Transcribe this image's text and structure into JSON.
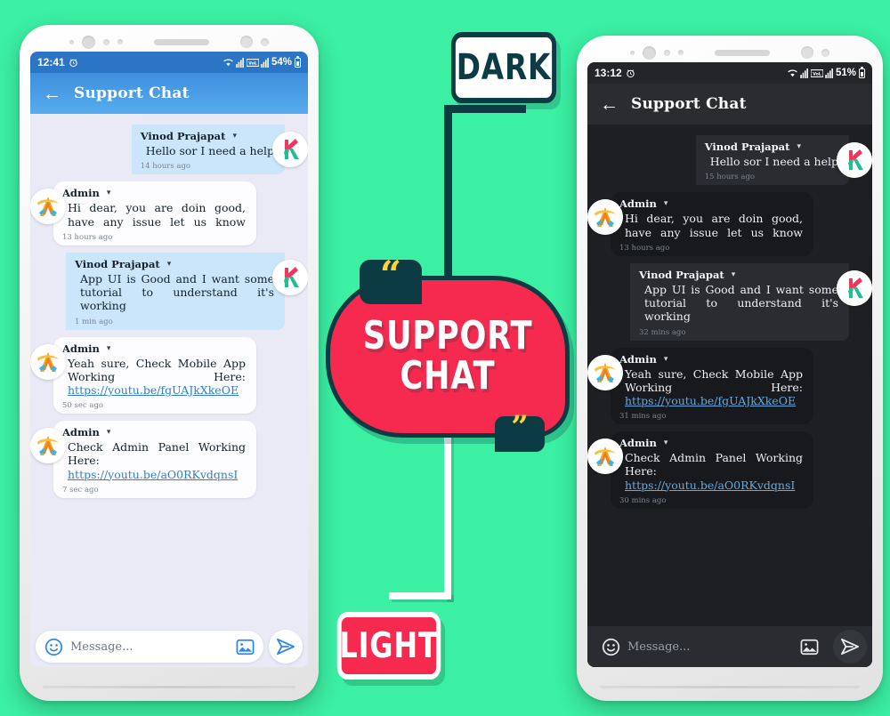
{
  "background_color": "#3BEFA3",
  "banner": {
    "line1": "SUPPORT",
    "line2": "CHAT",
    "quote_open": "“",
    "quote_close": "”",
    "color": "#F52A4E",
    "outline_color": "#0D3B44",
    "quote_color": "#FFD43B"
  },
  "labels": {
    "dark": "DARK",
    "light": "LIGHT"
  },
  "light_phone": {
    "status": {
      "time": "12:41",
      "battery": "54%",
      "wifi_icon": "wifi-icon",
      "signal_icon": "signal-icon",
      "alarm_icon": "alarm-icon"
    },
    "appbar": {
      "back_icon": "back-arrow-icon",
      "title": "Support Chat"
    },
    "messages": [
      {
        "sender": "Vinod Prajapat",
        "text": "Hello sor I need a help",
        "link": "",
        "time": "14 hours ago",
        "side": "right",
        "avatar": "k-logo-avatar"
      },
      {
        "sender": "Admin",
        "text": "Hi dear, you are doin good, have any issue let us know",
        "link": "",
        "time": "13 hours ago",
        "side": "left",
        "avatar": "a-logo-avatar"
      },
      {
        "sender": "Vinod Prajapat",
        "text": "App UI is Good and I want some tutorial to understand it's working",
        "link": "",
        "time": "1 min ago",
        "side": "right",
        "avatar": "k-logo-avatar"
      },
      {
        "sender": "Admin",
        "text": "Yeah sure, Check Mobile App Working Here:",
        "link": "https://youtu.be/fgUAJkXkeOE",
        "time": "50 sec ago",
        "side": "left",
        "avatar": "a-logo-avatar"
      },
      {
        "sender": "Admin",
        "text": "Check Admin Panel Working Here:",
        "link": "https://youtu.be/aO0RKvdqnsI",
        "time": "7 sec ago",
        "side": "left",
        "avatar": "a-logo-avatar"
      }
    ],
    "input": {
      "placeholder": "Message...",
      "emoji_icon": "emoji-icon",
      "image_icon": "image-attach-icon",
      "send_icon": "send-icon"
    }
  },
  "dark_phone": {
    "status": {
      "time": "13:12",
      "battery": "51%",
      "wifi_icon": "wifi-icon",
      "signal_icon": "signal-icon",
      "alarm_icon": "alarm-icon"
    },
    "appbar": {
      "back_icon": "back-arrow-icon",
      "title": "Support Chat"
    },
    "messages": [
      {
        "sender": "Vinod Prajapat",
        "text": "Hello sor I need a help",
        "link": "",
        "time": "15 hours ago",
        "side": "right",
        "avatar": "k-logo-avatar"
      },
      {
        "sender": "Admin",
        "text": "Hi dear, you are doin good, have any issue let us know",
        "link": "",
        "time": "13 hours ago",
        "side": "left",
        "avatar": "a-logo-avatar"
      },
      {
        "sender": "Vinod Prajapat",
        "text": "App UI is Good and I want some tutorial to understand it's working",
        "link": "",
        "time": "32 mins ago",
        "side": "right",
        "avatar": "k-logo-avatar"
      },
      {
        "sender": "Admin",
        "text": "Yeah sure, Check Mobile App Working Here:",
        "link": "https://youtu.be/fgUAJkXkeOE",
        "time": "31 mins ago",
        "side": "left",
        "avatar": "a-logo-avatar"
      },
      {
        "sender": "Admin",
        "text": "Check Admin Panel Working Here:",
        "link": "https://youtu.be/aO0RKvdqnsI",
        "time": "30 mins ago",
        "side": "left",
        "avatar": "a-logo-avatar"
      }
    ],
    "input": {
      "placeholder": "Message...",
      "emoji_icon": "emoji-icon",
      "image_icon": "image-attach-icon",
      "send_icon": "send-icon"
    }
  }
}
